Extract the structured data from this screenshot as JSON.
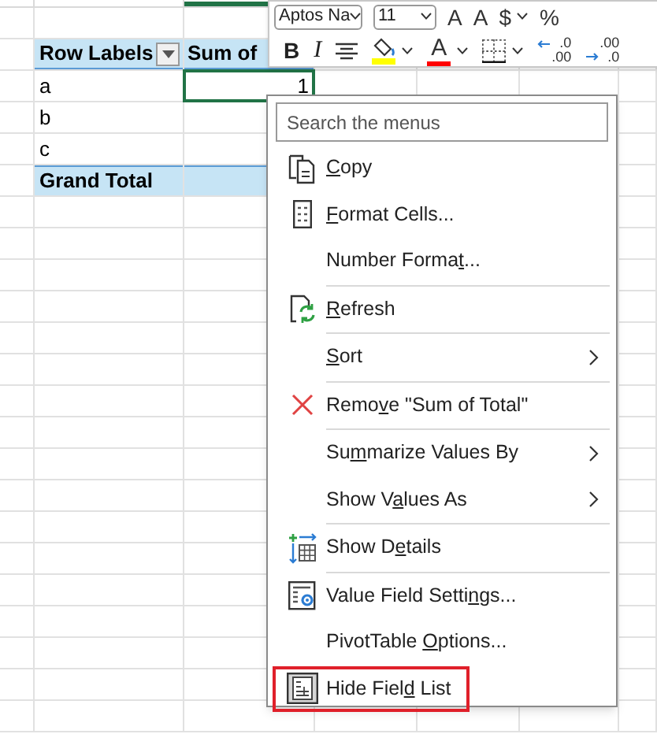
{
  "pivot": {
    "headers": [
      "Row Labels",
      "Sum of"
    ],
    "rows": [
      {
        "label": "a",
        "value": "1",
        "selected": true
      },
      {
        "label": "b",
        "selected": false
      },
      {
        "label": "c",
        "selected": false
      }
    ],
    "grand_total": "Grand Total"
  },
  "mini_toolbar": {
    "font": "Aptos Na",
    "size": "11",
    "row1": [
      {
        "kind": "text",
        "label": "A"
      },
      {
        "kind": "text",
        "label": "A"
      },
      {
        "kind": "text",
        "label": "$",
        "caret": true
      },
      {
        "kind": "text",
        "label": "%"
      }
    ],
    "row2": [
      {
        "kind": "bold",
        "label": "B"
      },
      {
        "kind": "italic",
        "label": "I"
      },
      {
        "kind": "align"
      },
      {
        "kind": "fill",
        "caret": true,
        "color": "#ffff00"
      },
      {
        "kind": "fontcolor",
        "label": "A",
        "caret": true,
        "color": "#ff0000"
      },
      {
        "kind": "borders",
        "caret": true
      },
      {
        "kind": "increase",
        "lines": [
          ".0",
          ".00"
        ]
      },
      {
        "kind": "decrease",
        "lines": [
          ".00",
          ".0"
        ]
      }
    ]
  },
  "context_menu": {
    "search": {
      "placeholder": "Search the menus"
    },
    "items": [
      {
        "kind": "copy",
        "key": "C",
        "post": "opy",
        "submenu": false,
        "highlighted": false
      },
      {
        "kind": "format",
        "key": "F",
        "post": "ormat Cells...",
        "submenu": false,
        "highlighted": false
      },
      {
        "kind": "plain",
        "pre": "Number Forma",
        "key": "t",
        "post": "...",
        "submenu": false,
        "highlighted": false
      },
      {
        "kind": "separator"
      },
      {
        "kind": "refresh",
        "key": "R",
        "post": "efresh",
        "submenu": false,
        "highlighted": false
      },
      {
        "kind": "separator"
      },
      {
        "kind": "plain",
        "key": "S",
        "post": "ort",
        "submenu": true,
        "highlighted": false
      },
      {
        "kind": "separator"
      },
      {
        "kind": "remove",
        "pre": "Remo",
        "key": "v",
        "post": "e \"Sum of Total\"",
        "submenu": false,
        "highlighted": false
      },
      {
        "kind": "separator"
      },
      {
        "kind": "plain",
        "pre": "Su",
        "key": "m",
        "post": "marize Values By",
        "submenu": true,
        "highlighted": false
      },
      {
        "kind": "plain",
        "pre": "Show V",
        "key": "a",
        "post": "lues As",
        "submenu": true,
        "highlighted": false
      },
      {
        "kind": "separator"
      },
      {
        "kind": "details",
        "pre": "Show D",
        "key": "e",
        "post": "tails",
        "submenu": false,
        "highlighted": false
      },
      {
        "kind": "separator"
      },
      {
        "kind": "settings",
        "pre": "Value Field Setti",
        "key": "n",
        "post": "gs...",
        "submenu": false,
        "highlighted": false
      },
      {
        "kind": "plain",
        "pre": "PivotTable ",
        "key": "O",
        "post": "ptions...",
        "submenu": false,
        "highlighted": false
      },
      {
        "kind": "fieldlist",
        "pre": "Hide Fiel",
        "key": "d",
        "post": " List",
        "submenu": false,
        "highlighted": true
      }
    ]
  }
}
